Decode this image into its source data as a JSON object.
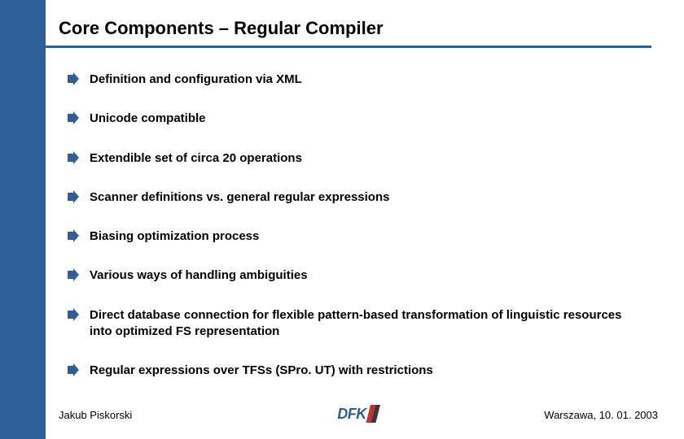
{
  "title": "Core Components – Regular Compiler",
  "bullets": [
    "Definition and configuration via XML",
    "Unicode compatible",
    "Extendible set of circa 20 operations",
    "Scanner definitions vs. general regular expressions",
    "Biasing optimization process",
    "Various ways of handling ambiguities",
    "Direct database connection for flexible pattern-based transformation of linguistic resources into optimized FS representation",
    "Regular expressions over TFSs (SPro. UT) with restrictions"
  ],
  "footer": {
    "author": "Jakub Piskorski",
    "logo_text": "DFK",
    "location_date": "Warszawa, 10. 01. 2003"
  },
  "colors": {
    "accent": "#2f5f97"
  }
}
